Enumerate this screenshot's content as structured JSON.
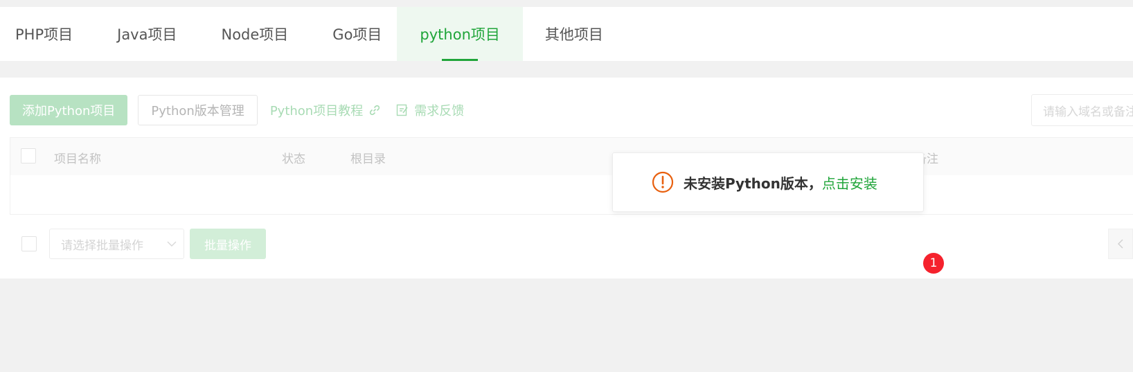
{
  "tabs": [
    {
      "label": "PHP项目",
      "active": false
    },
    {
      "label": "Java项目",
      "active": false
    },
    {
      "label": "Node项目",
      "active": false
    },
    {
      "label": "Go项目",
      "active": false
    },
    {
      "label": "python项目",
      "active": true
    },
    {
      "label": "其他项目",
      "active": false
    }
  ],
  "toolbar": {
    "add_label": "添加Python项目",
    "version_label": "Python版本管理",
    "tutorial_label": "Python项目教程",
    "feedback_label": "需求反馈"
  },
  "search": {
    "placeholder": "请输入域名或备注"
  },
  "table": {
    "headers": {
      "name": "项目名称",
      "status": "状态",
      "root": "根目录",
      "remark": "备注"
    }
  },
  "footer": {
    "select_placeholder": "请选择批量操作",
    "batch_label": "批量操作"
  },
  "toast": {
    "message": "未安装Python版本，",
    "action": "点击安装"
  },
  "badge": {
    "count": "1"
  },
  "colors": {
    "accent": "#20a53a",
    "warning": "#e8600f",
    "badge": "#f5222d"
  }
}
